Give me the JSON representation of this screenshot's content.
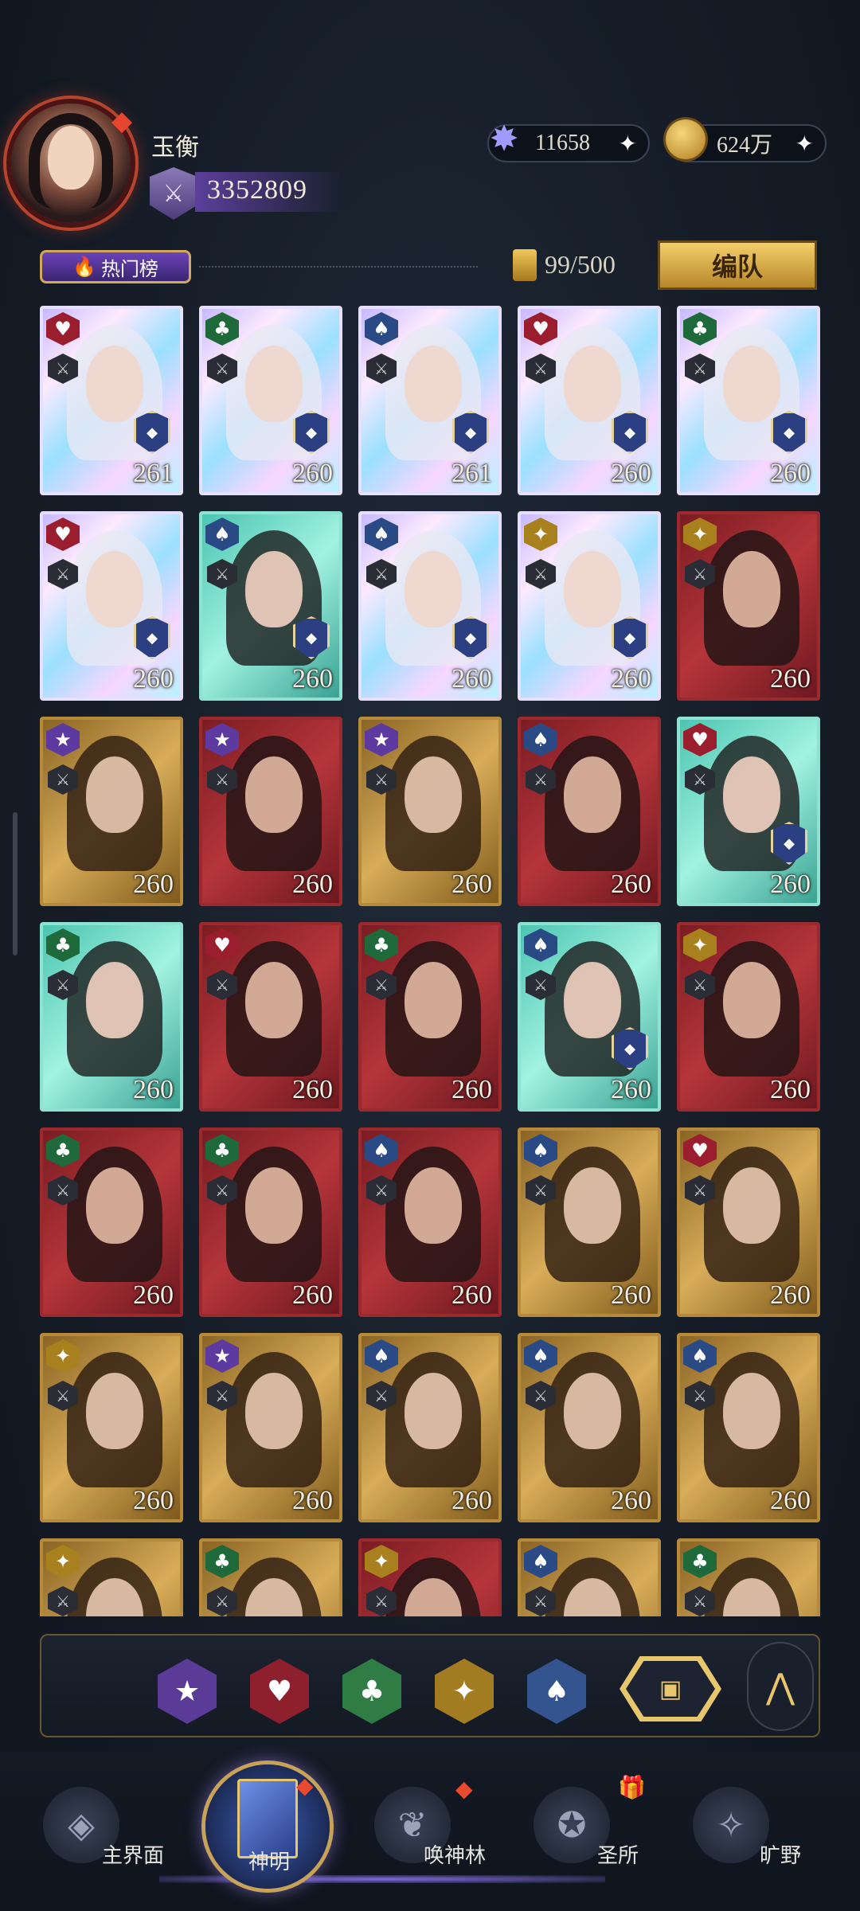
{
  "player": {
    "name": "玉衡",
    "power": "3352809"
  },
  "resources": {
    "crystal": "11658",
    "gold": "624万"
  },
  "toolbar": {
    "hot_tab": "热门榜",
    "capacity": "99/500",
    "team_button": "编队"
  },
  "cards": [
    {
      "suit": "heart",
      "lvl": "261",
      "style": "holo",
      "shield": true
    },
    {
      "suit": "club",
      "lvl": "260",
      "style": "holo",
      "shield": true
    },
    {
      "suit": "spade",
      "lvl": "261",
      "style": "holo",
      "shield": true
    },
    {
      "suit": "heart",
      "lvl": "260",
      "style": "holo",
      "shield": true
    },
    {
      "suit": "club",
      "lvl": "260",
      "style": "holo",
      "shield": true
    },
    {
      "suit": "heart",
      "lvl": "260",
      "style": "holo",
      "shield": true
    },
    {
      "suit": "spade",
      "lvl": "260",
      "style": "teal",
      "shield": true
    },
    {
      "suit": "spade",
      "lvl": "260",
      "style": "holo",
      "shield": true
    },
    {
      "suit": "diamond",
      "lvl": "260",
      "style": "holo",
      "shield": true
    },
    {
      "suit": "diamond",
      "lvl": "260",
      "style": "red",
      "shield": false
    },
    {
      "suit": "star",
      "lvl": "260",
      "style": "gold",
      "shield": false
    },
    {
      "suit": "star",
      "lvl": "260",
      "style": "red",
      "shield": false
    },
    {
      "suit": "star",
      "lvl": "260",
      "style": "gold",
      "shield": false
    },
    {
      "suit": "spade",
      "lvl": "260",
      "style": "red",
      "shield": false
    },
    {
      "suit": "heart",
      "lvl": "260",
      "style": "teal",
      "shield": true
    },
    {
      "suit": "club",
      "lvl": "260",
      "style": "teal",
      "shield": false
    },
    {
      "suit": "heart",
      "lvl": "260",
      "style": "red",
      "shield": false
    },
    {
      "suit": "club",
      "lvl": "260",
      "style": "red",
      "shield": false
    },
    {
      "suit": "spade",
      "lvl": "260",
      "style": "teal",
      "shield": true
    },
    {
      "suit": "diamond",
      "lvl": "260",
      "style": "red",
      "shield": false
    },
    {
      "suit": "club",
      "lvl": "260",
      "style": "red",
      "shield": false
    },
    {
      "suit": "club",
      "lvl": "260",
      "style": "red",
      "shield": false
    },
    {
      "suit": "spade",
      "lvl": "260",
      "style": "red",
      "shield": false
    },
    {
      "suit": "spade",
      "lvl": "260",
      "style": "gold",
      "shield": false
    },
    {
      "suit": "heart",
      "lvl": "260",
      "style": "gold",
      "shield": false
    },
    {
      "suit": "diamond",
      "lvl": "260",
      "style": "gold",
      "shield": false
    },
    {
      "suit": "star",
      "lvl": "260",
      "style": "gold",
      "shield": false
    },
    {
      "suit": "spade",
      "lvl": "260",
      "style": "gold",
      "shield": false
    },
    {
      "suit": "spade",
      "lvl": "260",
      "style": "gold",
      "shield": false
    },
    {
      "suit": "spade",
      "lvl": "260",
      "style": "gold",
      "shield": false
    },
    {
      "suit": "diamond",
      "lvl": "",
      "style": "gold",
      "shield": false
    },
    {
      "suit": "club",
      "lvl": "",
      "style": "gold",
      "shield": false
    },
    {
      "suit": "diamond",
      "lvl": "",
      "style": "red",
      "shield": false
    },
    {
      "suit": "spade",
      "lvl": "",
      "style": "gold",
      "shield": false
    },
    {
      "suit": "club",
      "lvl": "",
      "style": "gold",
      "shield": false
    }
  ],
  "filters": [
    "star",
    "heart",
    "club",
    "diamond",
    "spade",
    "all"
  ],
  "nav": {
    "main": "主界面",
    "deity": "神明",
    "summon": "唤神林",
    "sanctum": "圣所",
    "wild": "旷野"
  }
}
